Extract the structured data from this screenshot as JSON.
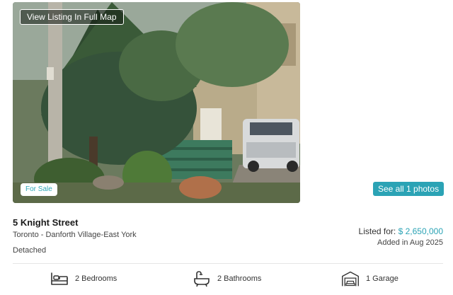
{
  "listing": {
    "map_button": "View Listing In Full Map",
    "status_badge": "For Sale",
    "photos_button": "See all 1 photos",
    "address": "5 Knight Street",
    "area": "Toronto - Danforth Village-East York",
    "property_type": "Detached",
    "price_label": "Listed for:",
    "price": "$ 2,650,000",
    "added": "Added in Aug 2025"
  },
  "features": [
    {
      "icon": "bed-icon",
      "label": "2 Bedrooms"
    },
    {
      "icon": "bathtub-icon",
      "label": "2 Bathrooms"
    },
    {
      "icon": "garage-icon",
      "label": "1 Garage"
    }
  ],
  "colors": {
    "accent": "#2ba3b5"
  }
}
